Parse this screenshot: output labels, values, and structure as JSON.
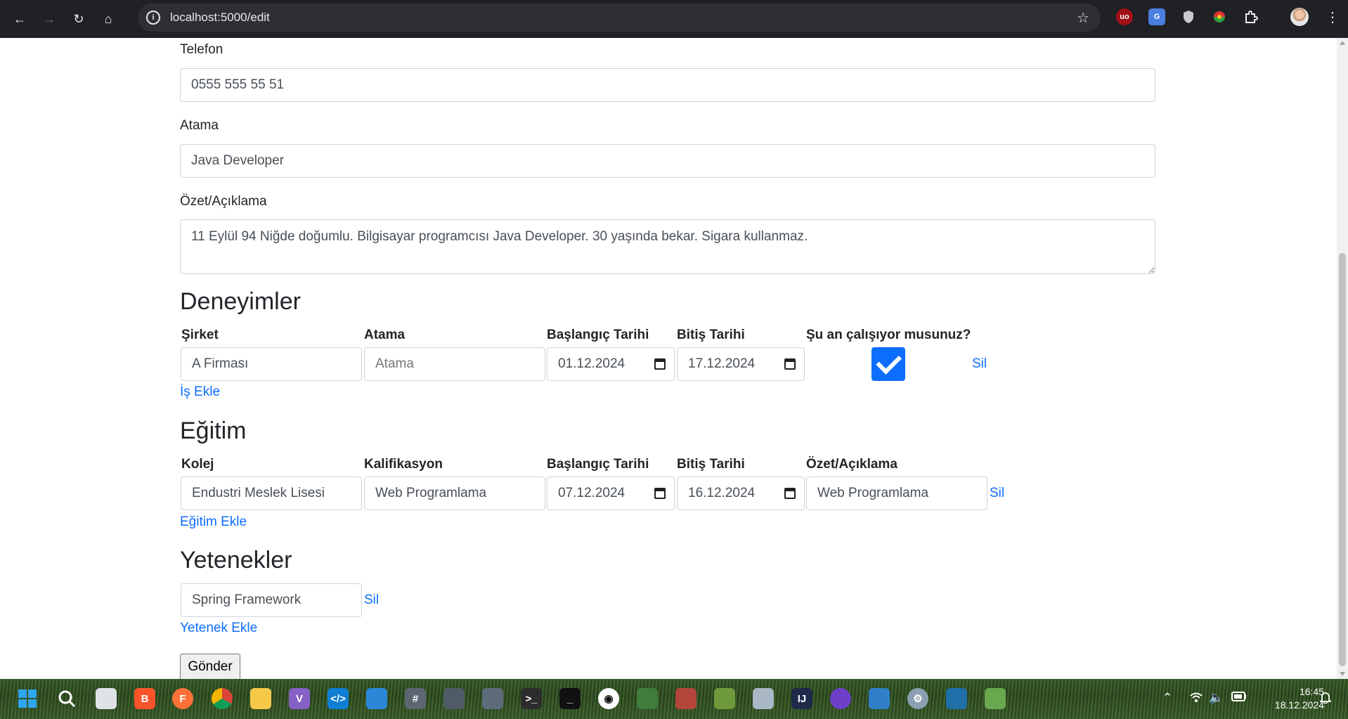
{
  "browser": {
    "url": "localhost:5000/edit"
  },
  "form": {
    "phone": {
      "label": "Telefon",
      "value": "0555 555 55 51"
    },
    "position": {
      "label": "Atama",
      "value": "Java Developer"
    },
    "summary": {
      "label": "Özet/Açıklama",
      "value": "11 Eylül 94 Niğde doğumlu. Bilgisayar programcısı Java Developer. 30 yaşında bekar. Sigara kullanmaz."
    }
  },
  "experience": {
    "title": "Deneyimler",
    "headers": {
      "company": "Şirket",
      "role": "Atama",
      "start": "Başlangıç Tarihi",
      "end": "Bitiş Tarihi",
      "current": "Şu an çalışıyor musunuz?"
    },
    "rows": [
      {
        "company": "A Firması",
        "role": "",
        "role_placeholder": "Atama",
        "start": "01.12.2024",
        "end": "17.12.2024",
        "current": true,
        "delete": "Sil"
      }
    ],
    "add": "İş Ekle"
  },
  "education": {
    "title": "Eğitim",
    "headers": {
      "school": "Kolej",
      "qualification": "Kalifikasyon",
      "start": "Başlangıç Tarihi",
      "end": "Bitiş Tarihi",
      "summary": "Özet/Açıklama"
    },
    "rows": [
      {
        "school": "Endustri Meslek Lisesi",
        "qualification": "Web Programlama",
        "start": "07.12.2024",
        "end": "16.12.2024",
        "summary": "Web Programlama",
        "delete": "Sil"
      }
    ],
    "add": "Eğitim Ekle"
  },
  "skills": {
    "title": "Yetenekler",
    "rows": [
      {
        "name": "Spring Framework",
        "delete": "Sil"
      }
    ],
    "add": "Yetenek Ekle"
  },
  "submit": "Gönder",
  "taskbar": {
    "time": "16:45",
    "date": "18.12.2024"
  },
  "colors": {
    "link": "#0d6efd",
    "chrome": "#202124"
  }
}
